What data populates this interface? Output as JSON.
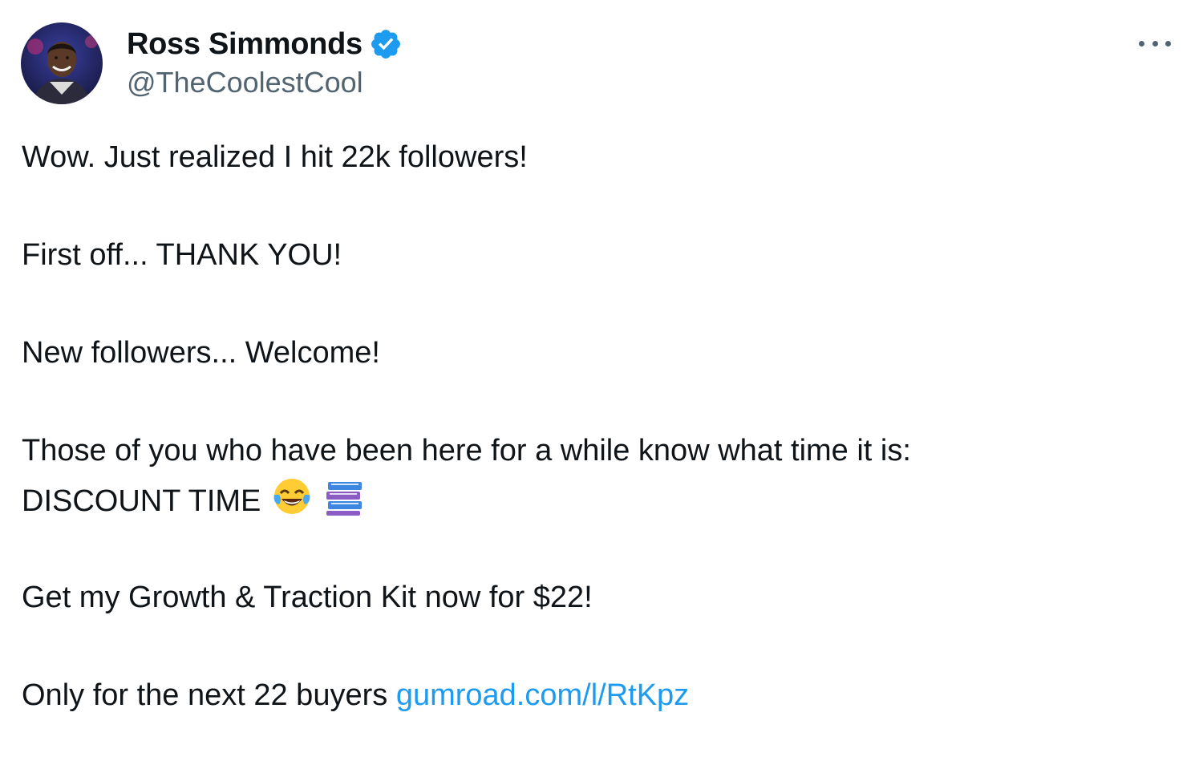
{
  "tweet": {
    "author": {
      "display_name": "Ross Simmonds",
      "handle": "@TheCoolestCool",
      "verified": true,
      "avatar_icon": "profile-photo"
    },
    "more_icon": "more-horizontal-icon",
    "lines": {
      "l1": "Wow. Just realized I hit 22k followers!",
      "l2": "First off... THANK YOU!",
      "l3": "New followers... Welcome!",
      "l4": "Those of you who have been here for a while know what time it is:",
      "l5": "DISCOUNT TIME",
      "l6": "Get my Growth & Traction Kit now for $22!",
      "l7": "Only for the next 22 buyers"
    },
    "emojis": [
      "face-with-tears-of-joy",
      "books"
    ],
    "link": "gumroad.com/l/RtKpz"
  },
  "colors": {
    "text": "#0f1419",
    "secondary": "#536471",
    "link": "#1d9bf0",
    "verified_badge": "#1d9bf0"
  }
}
